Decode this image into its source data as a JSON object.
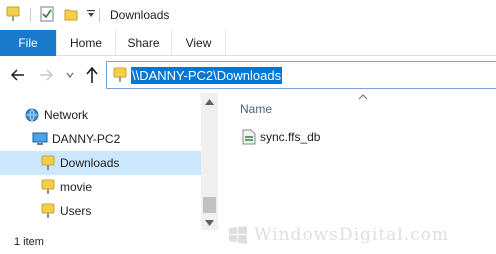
{
  "window": {
    "title": "Downloads"
  },
  "ribbon": {
    "tabs": [
      "File",
      "Home",
      "Share",
      "View"
    ]
  },
  "address": {
    "path": "\\\\DANNY-PC2\\Downloads"
  },
  "nav_pane": {
    "items": [
      {
        "label": "Network",
        "icon": "network-icon"
      },
      {
        "label": "DANNY-PC2",
        "icon": "computer-icon"
      },
      {
        "label": "Downloads",
        "icon": "folder-icon",
        "selected": true
      },
      {
        "label": "movie",
        "icon": "folder-icon"
      },
      {
        "label": "Users",
        "icon": "folder-icon"
      }
    ]
  },
  "content": {
    "column_header": "Name",
    "files": [
      {
        "name": "sync.ffs_db",
        "icon": "database-file-icon"
      }
    ]
  },
  "status": {
    "item_count": "1 item"
  },
  "watermark": {
    "text": "WindowsDigital.com"
  },
  "colors": {
    "file_tab": "#1979ca",
    "selection": "#0078d7",
    "tree_selected": "#cce8ff",
    "folder": "#f4cf4b"
  }
}
